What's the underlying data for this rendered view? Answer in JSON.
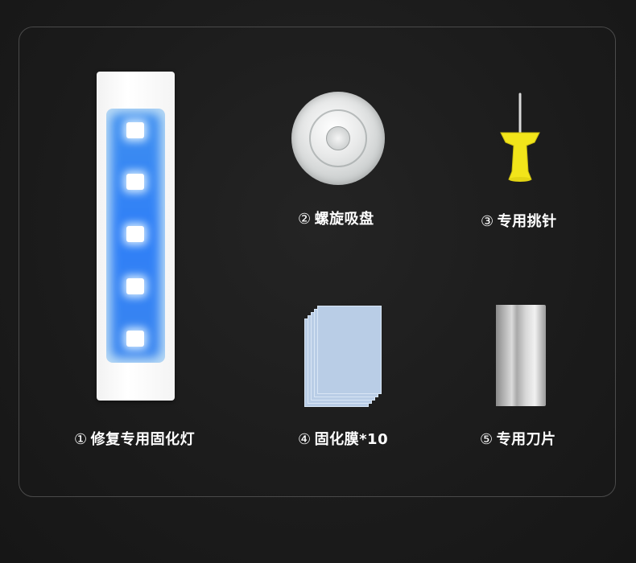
{
  "items": [
    {
      "num": "①",
      "name": "修复专用固化灯"
    },
    {
      "num": "②",
      "name": "螺旋吸盘"
    },
    {
      "num": "③",
      "name": "专用挑针"
    },
    {
      "num": "④",
      "name": "固化膜*10"
    },
    {
      "num": "⑤",
      "name": "专用刀片"
    }
  ],
  "colors": {
    "background": "#1a1a1a",
    "panel_border": "#4a4a4a",
    "led_blue": "#2f7ff7",
    "pin_yellow": "#f2e51a",
    "film_blue": "#b9cde6"
  },
  "icons": [
    "uv-lamp-image",
    "suction-cup-image",
    "push-pin-image",
    "curing-film-image",
    "blade-image"
  ]
}
